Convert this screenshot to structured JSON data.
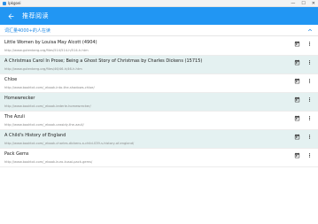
{
  "window": {
    "title": "lpkgoei",
    "controls": {
      "minimize": "—",
      "maximize": "☐",
      "close": "✕"
    }
  },
  "app_bar": {
    "title": "推荐阅读",
    "color": "#2196f3"
  },
  "section": {
    "title": "词汇量4000+的人在读"
  },
  "items": [
    {
      "title": "Little Women by Louisa May Alcott (4904)",
      "url": "http://www.gutenberg.org/files/514/514-h/514-h.htm",
      "alt": false
    },
    {
      "title": "A Christmas Carol In Prose; Being a Ghost Story of Christmas by Charles Dickens (15715)",
      "url": "http://www.gutenberg.org/files/46/46-h/46-h.htm",
      "alt": true
    },
    {
      "title": "Chloe",
      "url": "http://www.booktxt.com/_ebook-into-the-shadows-chloe/",
      "alt": false
    },
    {
      "title": "Homewrecker",
      "url": "http://www.booktxt.com/_ebook-lederle-homewrecker/",
      "alt": true
    },
    {
      "title": "The Azuli",
      "url": "http://www.booktxt.com/_ebook-cassidy-the-azuli/",
      "alt": false
    },
    {
      "title": "A Child's History of England",
      "url": "http://www.booktxt.com/_ebook-charles-dickens-a-child-039-s-history-of-england/",
      "alt": true
    },
    {
      "title": "Pack Gems",
      "url": "http://www.booktxt.com/_ebook-kuro-kusai-pack-gems/",
      "alt": false
    }
  ],
  "colors": {
    "accent": "#2196f3",
    "section_title": "#1e88e5",
    "alt_row": "#e4f1f1"
  }
}
